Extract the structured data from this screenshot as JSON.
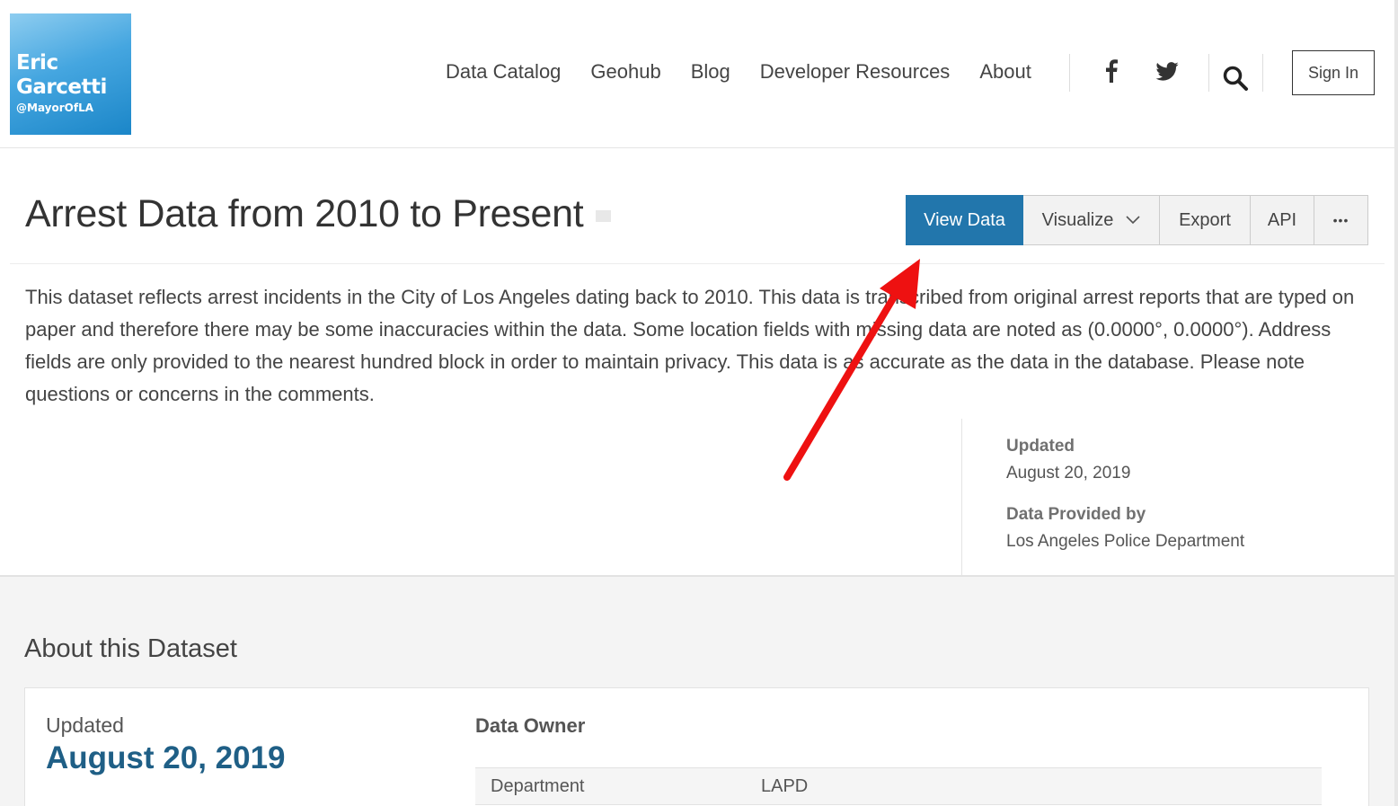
{
  "header": {
    "logo": {
      "name_line1": "Eric",
      "name_line2": "Garcetti",
      "handle": "@MayorOfLA"
    },
    "nav": [
      "Data Catalog",
      "Geohub",
      "Blog",
      "Developer Resources",
      "About"
    ],
    "icons": [
      "facebook-icon",
      "twitter-icon",
      "search-icon"
    ],
    "signin_label": "Sign In"
  },
  "dataset": {
    "title": "Arrest Data from 2010 to Present",
    "actions": {
      "view_data": "View Data",
      "visualize": "Visualize",
      "export": "Export",
      "api": "API",
      "more": "•••"
    },
    "description": "This dataset reflects arrest incidents in the City of Los Angeles dating back to 2010. This data is transcribed from original arrest reports that are typed on paper and therefore there may be some inaccuracies within the data. Some location fields with missing data are noted as (0.0000°, 0.0000°). Address fields are only provided to the nearest hundred block in order to maintain privacy. This data is as accurate as the data in the database. Please note questions or concerns in the comments.",
    "meta": {
      "updated_label": "Updated",
      "updated_value": "August 20, 2019",
      "provided_label": "Data Provided by",
      "provided_value": "Los Angeles Police Department"
    }
  },
  "about": {
    "title": "About this Dataset",
    "updated_label": "Updated",
    "updated_value": "August 20, 2019",
    "owner_heading": "Data Owner",
    "owner_rows": [
      {
        "key": "Department",
        "value": "LAPD"
      }
    ]
  },
  "colors": {
    "primary_button": "#2276ac",
    "annotation_arrow": "#ee1111",
    "date_accent": "#1f5f86"
  }
}
